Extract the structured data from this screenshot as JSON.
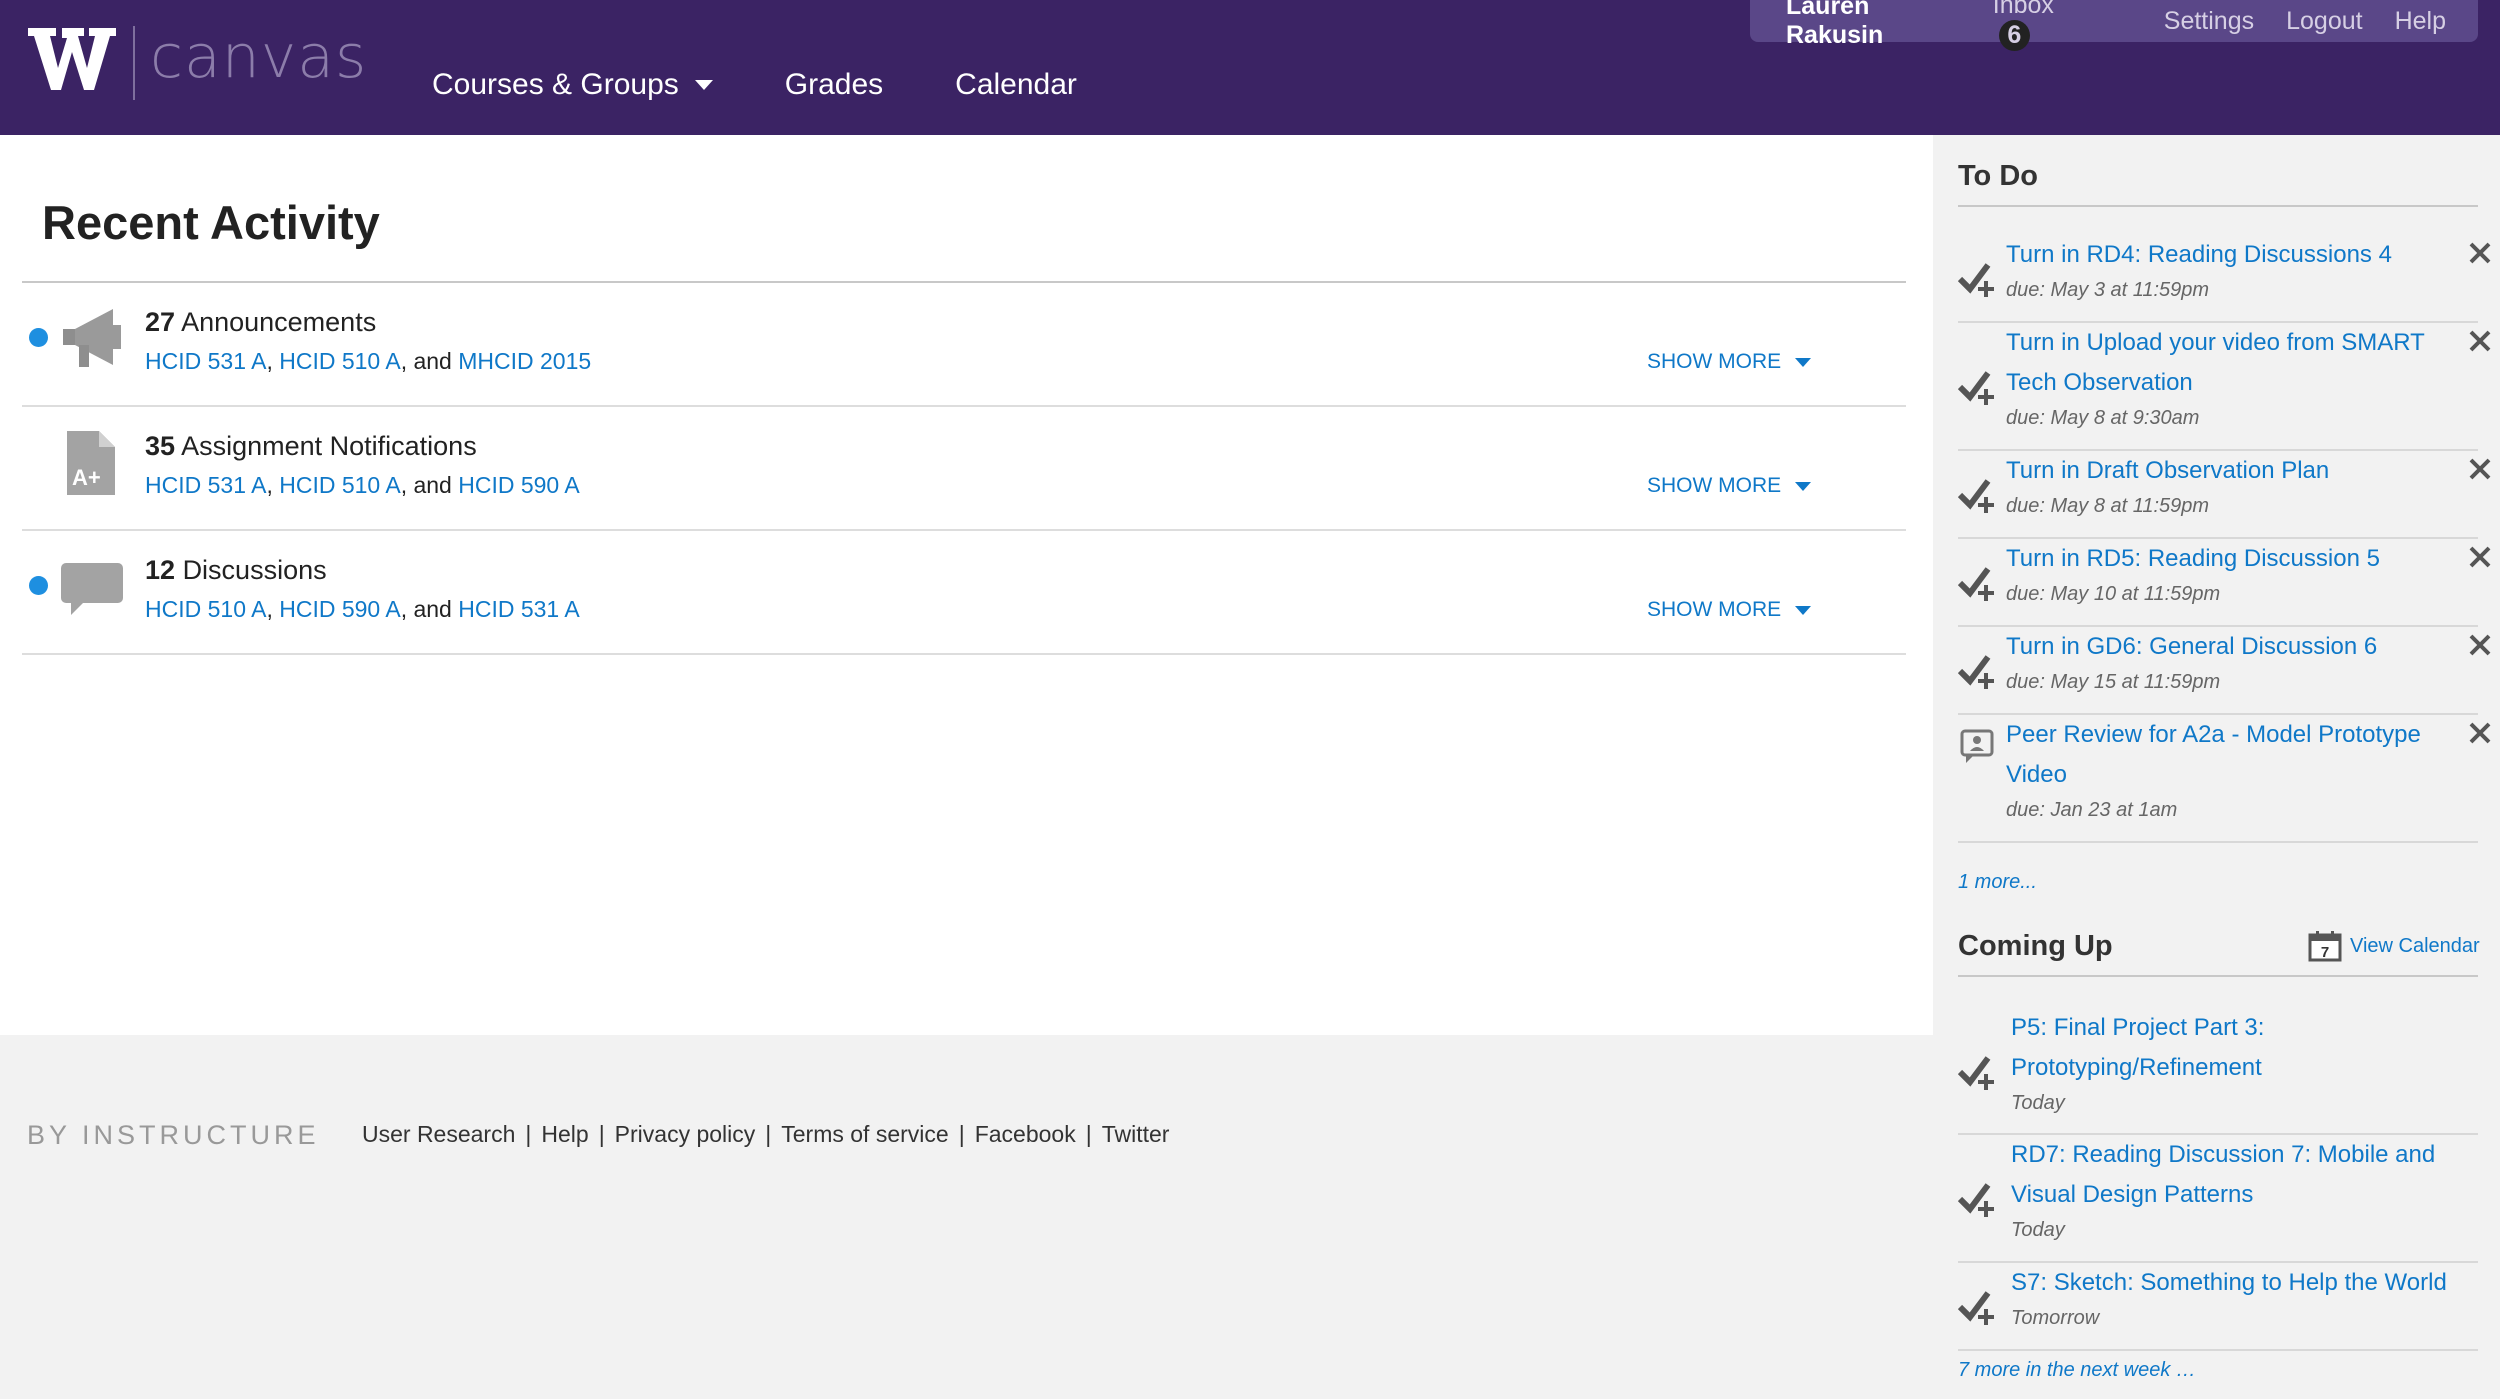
{
  "header": {
    "logo_text": "canvas",
    "nav": [
      {
        "label": "Courses & Groups"
      },
      {
        "label": "Grades"
      },
      {
        "label": "Calendar"
      }
    ],
    "user": {
      "name": "Lauren Rakusin",
      "inbox_label": "Inbox",
      "inbox_count": "6",
      "settings": "Settings",
      "logout": "Logout",
      "help": "Help"
    }
  },
  "main": {
    "title": "Recent Activity",
    "show_more": "SHOW MORE",
    "streams": [
      {
        "count": "27",
        "label": "Announcements",
        "icon": "megaphone-icon",
        "courses": [
          "HCID 531 A",
          "HCID 510 A",
          "MHCID 2015"
        ],
        "unread": true
      },
      {
        "count": "35",
        "label": "Assignment Notifications",
        "icon": "assignment-grade-icon",
        "courses": [
          "HCID 531 A",
          "HCID 510 A",
          "HCID 590 A"
        ],
        "unread": false
      },
      {
        "count": "12",
        "label": "Discussions",
        "icon": "discussion-bubble-icon",
        "courses": [
          "HCID 510 A",
          "HCID 590 A",
          "HCID 531 A"
        ],
        "unread": true
      }
    ],
    "comma": ",",
    "and": ", and"
  },
  "footer": {
    "brand": "BY INSTRUCTURE",
    "links": [
      "User Research",
      "Help",
      "Privacy policy",
      "Terms of service",
      "Facebook",
      "Twitter"
    ],
    "separator": "|"
  },
  "sidebar": {
    "todo_heading": "To Do",
    "todo": [
      {
        "title": "Turn in RD4: Reading Discussions 4",
        "due": "due: May 3 at 11:59pm",
        "icon": "checkmark-plus-icon"
      },
      {
        "title": "Turn in Upload your video from SMART Tech Observation",
        "due": "due: May 8 at 9:30am",
        "icon": "checkmark-plus-icon"
      },
      {
        "title": "Turn in Draft Observation Plan",
        "due": "due: May 8 at 11:59pm",
        "icon": "checkmark-plus-icon"
      },
      {
        "title": "Turn in RD5: Reading Discussion 5",
        "due": "due: May 10 at 11:59pm",
        "icon": "checkmark-plus-icon"
      },
      {
        "title": "Turn in GD6: General Discussion 6",
        "due": "due: May 15 at 11:59pm",
        "icon": "checkmark-plus-icon"
      },
      {
        "title": "Peer Review for A2a - Model Prototype Video",
        "due": "due: Jan 23 at 1am",
        "icon": "peer-review-icon"
      }
    ],
    "todo_more": "1 more...",
    "coming_up_heading": "Coming Up",
    "view_calendar": "View Calendar",
    "calendar_day": "7",
    "coming_up": [
      {
        "title": "P5: Final Project Part 3: Prototyping/Refinement",
        "when": "Today"
      },
      {
        "title": "RD7: Reading Discussion 7: Mobile and Visual Design Patterns",
        "when": "Today"
      },
      {
        "title": "S7: Sketch: Something to Help the World",
        "when": "Tomorrow"
      }
    ],
    "coming_up_more": "7 more in the next week …"
  },
  "colors": {
    "header_bg": "#3b2364",
    "link": "#0f78c8",
    "unread_dot": "#1e8fe0",
    "sidebar_bg": "#f2f2f2"
  }
}
